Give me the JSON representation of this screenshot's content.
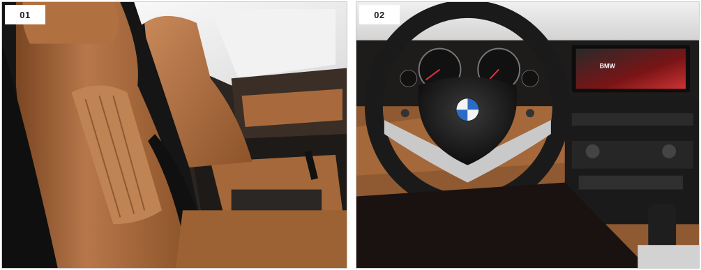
{
  "panels": [
    {
      "label": "01",
      "subject": "front-seats",
      "colors": {
        "leather": "#a86a3c",
        "black": "#141414",
        "trim": "#c79466"
      }
    },
    {
      "label": "02",
      "subject": "steering-wheel-dashboard",
      "colors": {
        "wheel": "#1c1c1c",
        "silver": "#cfcfcf",
        "leather": "#a4683a",
        "screen": "#b52426"
      }
    }
  ],
  "display": {
    "logo_text": "BMW"
  }
}
